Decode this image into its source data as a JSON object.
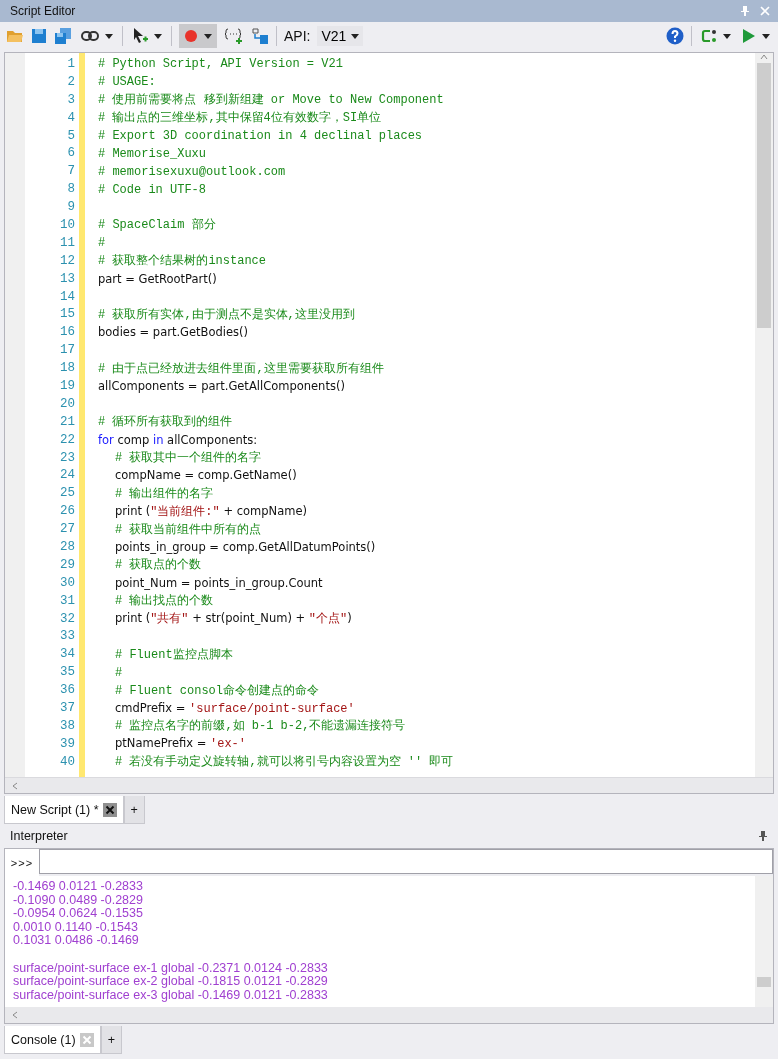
{
  "window": {
    "title": "Script Editor"
  },
  "toolbar": {
    "api_label": "API:",
    "api_version": "V21"
  },
  "editor": {
    "lines": [
      {
        "n": "1",
        "indented": false,
        "segs": [
          {
            "kind": "comment",
            "text": "# Python Script, API Version = V21"
          }
        ]
      },
      {
        "n": "2",
        "indented": false,
        "segs": [
          {
            "kind": "comment",
            "text": "# USAGE:"
          }
        ]
      },
      {
        "n": "3",
        "indented": false,
        "segs": [
          {
            "kind": "comment",
            "text": "# 使用前需要将点 移到新组建 or Move to New Component"
          }
        ]
      },
      {
        "n": "4",
        "indented": false,
        "segs": [
          {
            "kind": "comment",
            "text": "# 输出点的三维坐标,其中保留4位有效数字，SI单位"
          }
        ]
      },
      {
        "n": "5",
        "indented": false,
        "segs": [
          {
            "kind": "comment",
            "text": "# Export 3D coordination in 4 declinal places"
          }
        ]
      },
      {
        "n": "6",
        "indented": false,
        "segs": [
          {
            "kind": "comment",
            "text": "# Memorise_Xuxu"
          }
        ]
      },
      {
        "n": "7",
        "indented": false,
        "segs": [
          {
            "kind": "comment",
            "text": "# memorisexuxu@outlook.com"
          }
        ]
      },
      {
        "n": "8",
        "indented": false,
        "segs": [
          {
            "kind": "comment",
            "text": "# Code in UTF-8"
          }
        ]
      },
      {
        "n": "9"
      },
      {
        "n": "10",
        "indented": false,
        "segs": [
          {
            "kind": "comment",
            "text": "# SpaceClaim 部分"
          }
        ]
      },
      {
        "n": "11",
        "indented": false,
        "segs": [
          {
            "kind": "comment",
            "text": "#"
          }
        ]
      },
      {
        "n": "12",
        "indented": false,
        "segs": [
          {
            "kind": "comment",
            "text": "# 获取整个结果树的instance"
          }
        ]
      },
      {
        "n": "13",
        "indented": false,
        "segs": [
          {
            "kind": "code",
            "text": "part = GetRootPart()"
          }
        ]
      },
      {
        "n": "14"
      },
      {
        "n": "15",
        "indented": false,
        "segs": [
          {
            "kind": "comment",
            "text": "# 获取所有实体,由于测点不是实体,这里没用到"
          }
        ]
      },
      {
        "n": "16",
        "indented": false,
        "segs": [
          {
            "kind": "code",
            "text": "bodies = part.GetBodies()"
          }
        ]
      },
      {
        "n": "17"
      },
      {
        "n": "18",
        "indented": false,
        "segs": [
          {
            "kind": "comment",
            "text": "# 由于点已经放进去组件里面,这里需要获取所有组件"
          }
        ]
      },
      {
        "n": "19",
        "indented": false,
        "segs": [
          {
            "kind": "code",
            "text": "allComponents = part.GetAllComponents()"
          }
        ]
      },
      {
        "n": "20"
      },
      {
        "n": "21",
        "indented": false,
        "segs": [
          {
            "kind": "comment",
            "text": "# 循环所有获取到的组件"
          }
        ]
      },
      {
        "n": "22",
        "indented": false,
        "segs": [
          {
            "kind": "keyword",
            "text": "for"
          },
          {
            "kind": "code",
            "text": " comp "
          },
          {
            "kind": "keyword",
            "text": "in"
          },
          {
            "kind": "code",
            "text": " allComponents:"
          }
        ]
      },
      {
        "n": "23",
        "indented": true,
        "segs": [
          {
            "kind": "comment",
            "text": "# 获取其中一个组件的名字"
          }
        ]
      },
      {
        "n": "24",
        "indented": true,
        "segs": [
          {
            "kind": "code",
            "text": "compName = comp.GetName()"
          }
        ]
      },
      {
        "n": "25",
        "indented": true,
        "segs": [
          {
            "kind": "comment",
            "text": "# 输出组件的名字"
          }
        ]
      },
      {
        "n": "26",
        "indented": true,
        "segs": [
          {
            "kind": "code",
            "text": "print ("
          },
          {
            "kind": "string",
            "text": "\"当前组件:\""
          },
          {
            "kind": "code",
            "text": " + compName)"
          }
        ]
      },
      {
        "n": "27",
        "indented": true,
        "segs": [
          {
            "kind": "comment",
            "text": "# 获取当前组件中所有的点"
          }
        ]
      },
      {
        "n": "28",
        "indented": true,
        "segs": [
          {
            "kind": "code",
            "text": "points_in_group = comp.GetAllDatumPoints()"
          }
        ]
      },
      {
        "n": "29",
        "indented": true,
        "segs": [
          {
            "kind": "comment",
            "text": "# 获取点的个数"
          }
        ]
      },
      {
        "n": "30",
        "indented": true,
        "segs": [
          {
            "kind": "code",
            "text": "point_Num = points_in_group.Count"
          }
        ]
      },
      {
        "n": "31",
        "indented": true,
        "segs": [
          {
            "kind": "comment",
            "text": "# 输出找点的个数"
          }
        ]
      },
      {
        "n": "32",
        "indented": true,
        "segs": [
          {
            "kind": "code",
            "text": "print ("
          },
          {
            "kind": "string",
            "text": "\"共有\""
          },
          {
            "kind": "code",
            "text": " + str(point_Num) + "
          },
          {
            "kind": "string",
            "text": "\"个点\""
          },
          {
            "kind": "code",
            "text": ")"
          }
        ]
      },
      {
        "n": "33"
      },
      {
        "n": "34",
        "indented": true,
        "segs": [
          {
            "kind": "comment",
            "text": "# Fluent监控点脚本"
          }
        ]
      },
      {
        "n": "35",
        "indented": true,
        "segs": [
          {
            "kind": "comment",
            "text": "#"
          }
        ]
      },
      {
        "n": "36",
        "indented": true,
        "segs": [
          {
            "kind": "comment",
            "text": "# Fluent consol命令创建点的命令"
          }
        ]
      },
      {
        "n": "37",
        "indented": true,
        "segs": [
          {
            "kind": "code",
            "text": "cmdPrefix = "
          },
          {
            "kind": "string",
            "text": "'surface/point-surface'"
          }
        ]
      },
      {
        "n": "38",
        "indented": true,
        "segs": [
          {
            "kind": "comment",
            "text": "# 监控点名字的前缀,如 b-1 b-2,不能遗漏连接符号"
          }
        ]
      },
      {
        "n": "39",
        "indented": true,
        "segs": [
          {
            "kind": "code",
            "text": "ptNamePrefix = "
          },
          {
            "kind": "string",
            "text": "'ex-'"
          }
        ]
      },
      {
        "n": "40",
        "indented": true,
        "segs": [
          {
            "kind": "comment",
            "text": "# 若没有手动定义旋转轴,就可以将引号内容设置为空 '' 即可"
          }
        ]
      }
    ]
  },
  "editor_tabs": [
    {
      "label": "New Script (1) *",
      "selected": true
    },
    {
      "label": "+",
      "selected": false
    }
  ],
  "interpreter": {
    "title": "Interpreter",
    "prompt": ">>>",
    "output_blocks": [
      [
        "-0.1469 0.0121 -0.2833",
        "-0.1090 0.0489 -0.2829",
        "-0.0954 0.0624 -0.1535",
        "0.0010 0.1140 -0.1543",
        "0.1031 0.0486 -0.1469"
      ],
      [
        "surface/point-surface ex-1 global -0.2371 0.0124 -0.2833",
        "surface/point-surface ex-2 global -0.1815 0.0121 -0.2829",
        "surface/point-surface ex-3 global -0.1469 0.0121 -0.2833"
      ]
    ]
  },
  "console_tabs": [
    {
      "label": "Console (1)",
      "selected": true
    },
    {
      "label": "+",
      "selected": false
    }
  ]
}
